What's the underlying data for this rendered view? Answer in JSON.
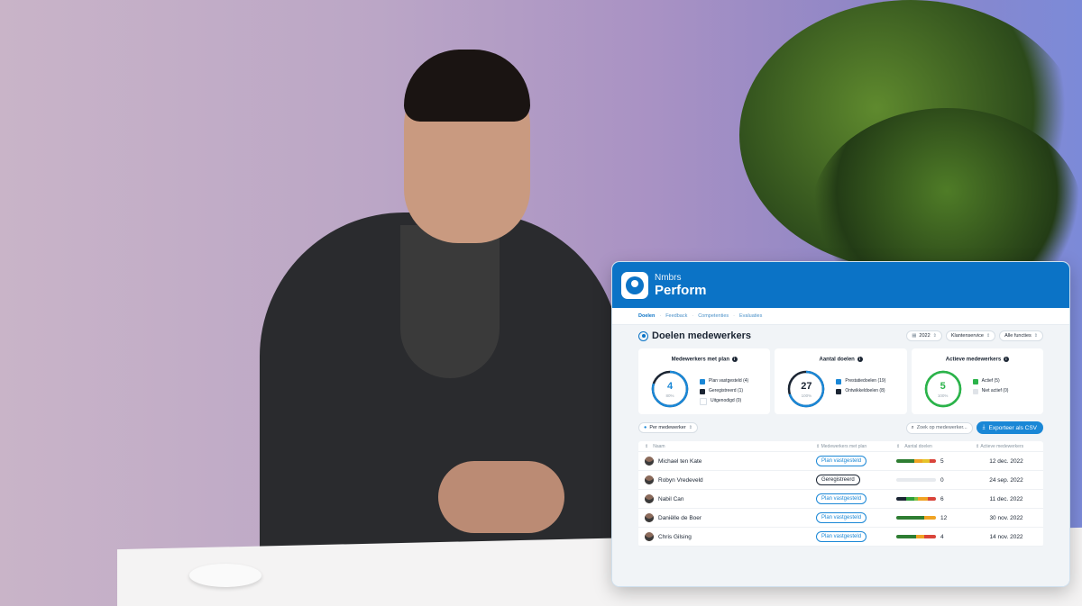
{
  "colors": {
    "accent": "#0b73c6",
    "green": "#2e9e3b",
    "dark": "#1b2533",
    "orange": "#f0a323",
    "red": "#d9443a",
    "yellow": "#e5c32a"
  },
  "app": {
    "brand_small": "Nmbrs",
    "brand_big": "Perform"
  },
  "nav": {
    "tabs": [
      "Doelen",
      "Feedback",
      "Competenties",
      "Evaluaties"
    ],
    "active": "Doelen"
  },
  "page": {
    "title": "Doelen medewerkers"
  },
  "filters": {
    "year": "2022",
    "team": "Klantenservice",
    "functions": "Alle functies"
  },
  "cards": [
    {
      "title": "Medewerkers met plan",
      "value": "4",
      "pct": "80%",
      "progress": 0.8,
      "ring_color": "#1a87d6",
      "legend": [
        {
          "label": "Plan vastgesteld (4)",
          "color": "#1a87d6"
        },
        {
          "label": "Geregistreerd (1)",
          "color": "#1b2533"
        },
        {
          "label": "Uitgenodigd (0)",
          "color": "#ffffff"
        }
      ]
    },
    {
      "title": "Aantal doelen",
      "value": "27",
      "pct": "100%",
      "progress": 0.7,
      "ring_color": "#1a87d6",
      "legend": [
        {
          "label": "Prestatiedoelen (19)",
          "color": "#1a87d6"
        },
        {
          "label": "Ontwikkeldoelen (8)",
          "color": "#1b2533"
        }
      ]
    },
    {
      "title": "Actieve medewerkers",
      "value": "5",
      "pct": "100%",
      "progress": 1.0,
      "ring_color": "#2bb34a",
      "legend": [
        {
          "label": "Actief (5)",
          "color": "#2bb34a"
        },
        {
          "label": "Niet actief (0)",
          "color": "#dfe3e8"
        }
      ]
    }
  ],
  "toolbar": {
    "group_by": "Per medewerker",
    "search_placeholder": "Zoek op medewerker...",
    "export_label": "Exporteer als CSV"
  },
  "table": {
    "headers": [
      "Naam",
      "Medewerkers met plan",
      "Aantal doelen",
      "Actieve medewerkers"
    ],
    "rows": [
      {
        "name": "Michael ten Kate",
        "plan": "Plan vastgesteld",
        "goals": "5",
        "active": "12 dec. 2022",
        "bar": [
          {
            "v": 0.45,
            "c": "#2e7d32"
          },
          {
            "v": 0.2,
            "c": "#f0a323"
          },
          {
            "v": 0.2,
            "c": "#e5c32a"
          },
          {
            "v": 0.15,
            "c": "#d9443a"
          }
        ]
      },
      {
        "name": "Robyn Vredeveld",
        "plan": "Geregistreerd",
        "goals": "0",
        "active": "24 sep. 2022",
        "bar": []
      },
      {
        "name": "Nabil Can",
        "plan": "Plan vastgesteld",
        "goals": "6",
        "active": "11 dec. 2022",
        "bar": [
          {
            "v": 0.25,
            "c": "#1b2533"
          },
          {
            "v": 0.2,
            "c": "#2e9e3b"
          },
          {
            "v": 0.1,
            "c": "#7cc043"
          },
          {
            "v": 0.25,
            "c": "#f0a323"
          },
          {
            "v": 0.2,
            "c": "#d9443a"
          }
        ]
      },
      {
        "name": "Daniëlle de Boer",
        "plan": "Plan vastgesteld",
        "goals": "12",
        "active": "30 nov. 2022",
        "bar": [
          {
            "v": 0.7,
            "c": "#2e7d32"
          },
          {
            "v": 0.3,
            "c": "#f0a323"
          }
        ]
      },
      {
        "name": "Chris Gilsing",
        "plan": "Plan vastgesteld",
        "goals": "4",
        "active": "14 nov. 2022",
        "bar": [
          {
            "v": 0.5,
            "c": "#2e7d32"
          },
          {
            "v": 0.2,
            "c": "#f0a323"
          },
          {
            "v": 0.3,
            "c": "#d9443a"
          }
        ]
      }
    ]
  }
}
